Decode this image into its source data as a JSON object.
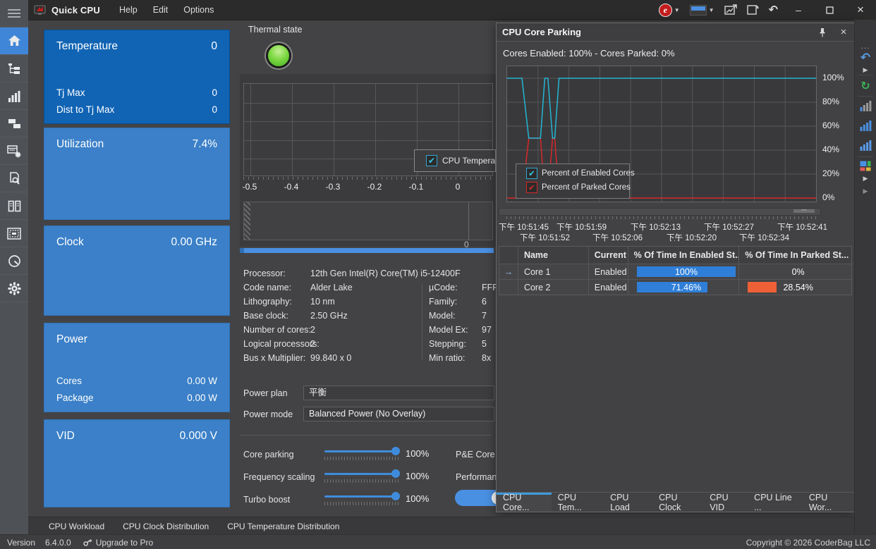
{
  "titlebar": {
    "app_title": "Quick CPU",
    "menu_items": [
      "Help",
      "Edit",
      "Options"
    ],
    "icons": [
      "brand-badge",
      "theme-swatch",
      "export-chart",
      "reset-layout",
      "undo"
    ],
    "window_controls": [
      "minimize",
      "maximize",
      "close"
    ]
  },
  "sidebar": {
    "items": [
      {
        "name": "menu",
        "active": false
      },
      {
        "name": "home",
        "active": true
      },
      {
        "name": "system-tree",
        "active": false
      },
      {
        "name": "performance-bars",
        "active": false
      },
      {
        "name": "windows-layout",
        "active": false
      },
      {
        "name": "table-settings",
        "active": false
      },
      {
        "name": "report-inspect",
        "active": false
      },
      {
        "name": "columns-view",
        "active": false
      },
      {
        "name": "cpu-chip",
        "active": false
      },
      {
        "name": "gauge",
        "active": false
      },
      {
        "name": "settings-gear",
        "active": false
      }
    ]
  },
  "cards": [
    {
      "title": "Temperature",
      "value": "0",
      "variant": "dark",
      "rows": [
        {
          "label": "Tj Max",
          "value": "0"
        },
        {
          "label": "Dist to Tj Max",
          "value": "0"
        }
      ]
    },
    {
      "title": "Utilization",
      "value": "7.4%",
      "variant": "light",
      "rows": []
    },
    {
      "title": "Clock",
      "value": "0.00 GHz",
      "variant": "light",
      "rows": []
    },
    {
      "title": "Power",
      "value": "",
      "variant": "light",
      "rows": [
        {
          "label": "Cores",
          "value": "0.00 W"
        },
        {
          "label": "Package",
          "value": "0.00 W"
        }
      ]
    },
    {
      "title": "VID",
      "value": "0.000 V",
      "variant": "light",
      "rows": []
    }
  ],
  "thermal": {
    "label": "Thermal state",
    "led_color": "#6dd63c"
  },
  "temp_chart": {
    "x_ticks": [
      "-0.5",
      "-0.4",
      "-0.3",
      "-0.2",
      "-0.1",
      "0"
    ],
    "legend_label": "CPU Temperatur",
    "overview_value": "0"
  },
  "processor_info": {
    "left": [
      [
        "Processor:",
        "12th Gen Intel(R) Core(TM) i5-12400F"
      ],
      [
        "Code name:",
        "Alder Lake"
      ],
      [
        "Lithography:",
        "10 nm"
      ],
      [
        "Base clock:",
        "2.50 GHz"
      ],
      [
        "Number of cores:",
        "2"
      ],
      [
        "Logical processors:",
        "2"
      ],
      [
        "Bus x Multiplier:",
        "99.840 x 0"
      ]
    ],
    "right": [
      [
        "µCode:",
        "FFF"
      ],
      [
        "Family:",
        "6"
      ],
      [
        "Model:",
        "7"
      ],
      [
        "Model Ex:",
        "97"
      ],
      [
        "Stepping:",
        "5"
      ],
      [
        "Min ratio:",
        "8x"
      ]
    ]
  },
  "power_settings": {
    "plan_label": "Power plan",
    "plan_value": "平衡",
    "mode_label": "Power mode",
    "mode_value": "Balanced Power (No Overlay)",
    "sliders": [
      {
        "label": "Core parking",
        "value": "100%",
        "percent": 100
      },
      {
        "label": "Frequency scaling",
        "value": "100%",
        "percent": 100
      },
      {
        "label": "Turbo boost",
        "value": "100%",
        "percent": 100
      }
    ],
    "side_labels": [
      "P&E Core",
      "Performan"
    ]
  },
  "core_parking": {
    "title": "CPU Core Parking",
    "status": "Cores Enabled: 100% - Cores Parked: 0%",
    "chart_data": {
      "type": "line",
      "ylim": [
        0,
        100
      ],
      "y_ticks": [
        "100%",
        "80%",
        "60%",
        "40%",
        "20%",
        "0%"
      ],
      "grid": true,
      "legend_position": "bottom-left",
      "series": [
        {
          "name": "Percent of Enabled Cores",
          "color": "#24b6d4",
          "points": [
            [
              0,
              100
            ],
            [
              0.048,
              100
            ],
            [
              0.07,
              50
            ],
            [
              0.108,
              50
            ],
            [
              0.122,
              100
            ],
            [
              0.132,
              100
            ],
            [
              0.147,
              50
            ],
            [
              0.154,
              50
            ],
            [
              0.168,
              100
            ],
            [
              1,
              100
            ]
          ]
        },
        {
          "name": "Percent of Parked Cores",
          "color": "#d8282a",
          "points": [
            [
              0,
              0
            ],
            [
              0.048,
              0
            ],
            [
              0.07,
              50
            ],
            [
              0.108,
              50
            ],
            [
              0.122,
              0
            ],
            [
              0.132,
              0
            ],
            [
              0.147,
              50
            ],
            [
              0.154,
              50
            ],
            [
              0.168,
              0
            ],
            [
              1,
              0
            ]
          ]
        }
      ],
      "x_labels_row1": [
        "下午 10:51:45",
        "下午 10:51:59",
        "下午 10:52:13",
        "下午 10:52:27",
        "下午 10:52:41"
      ],
      "x_labels_row2": [
        "下午 10:51:52",
        "下午 10:52:06",
        "下午 10:52:20",
        "下午 10:52:34"
      ]
    },
    "table": {
      "columns": [
        "Name",
        "Current",
        "% Of Time In Enabled St...",
        "% Of Time In Parked St..."
      ],
      "rows": [
        {
          "name": "Core 1",
          "current": "Enabled",
          "enabled_label": "100%",
          "enabled_pct": 100,
          "parked_label": "0%",
          "parked_pct": 0,
          "selected": true
        },
        {
          "name": "Core 2",
          "current": "Enabled",
          "enabled_label": "71.46%",
          "enabled_pct": 71.46,
          "parked_label": "28.54%",
          "parked_pct": 28.54,
          "selected": false
        }
      ]
    },
    "tabs": [
      {
        "label": "CPU Core...",
        "active": true
      },
      {
        "label": "CPU Tem...",
        "active": false
      },
      {
        "label": "CPU Load",
        "active": false
      },
      {
        "label": "CPU Clock",
        "active": false
      },
      {
        "label": "CPU VID",
        "active": false
      },
      {
        "label": "CPU Line ...",
        "active": false
      },
      {
        "label": "CPU Wor...",
        "active": false
      }
    ]
  },
  "right_rail": {
    "items": [
      "ellipsis",
      "undo",
      "expand-arrow",
      "refresh",
      "bar-chart-gray",
      "bar-chart-blue",
      "bar-chart-blue-2",
      "color-squares",
      "expand-arrow-2",
      "expand-arrow-3"
    ]
  },
  "bottom_tabs": [
    "CPU Workload",
    "CPU Clock Distribution",
    "CPU Temperature Distribution"
  ],
  "statusbar": {
    "version_label": "Version",
    "version": "6.4.0.0",
    "upgrade_label": "Upgrade to Pro",
    "copyright": "Copyright © 2026 CoderBag LLC"
  },
  "colors": {
    "accent_blue": "#3f86d8",
    "card_dark": "#1164b4",
    "card_light": "#3b80c8",
    "enabled_line": "#24b6d4",
    "parked_line": "#d8282a",
    "bar_blue": "#2f7fd8",
    "bar_orange": "#f06036",
    "led_green": "#6dd63c"
  }
}
